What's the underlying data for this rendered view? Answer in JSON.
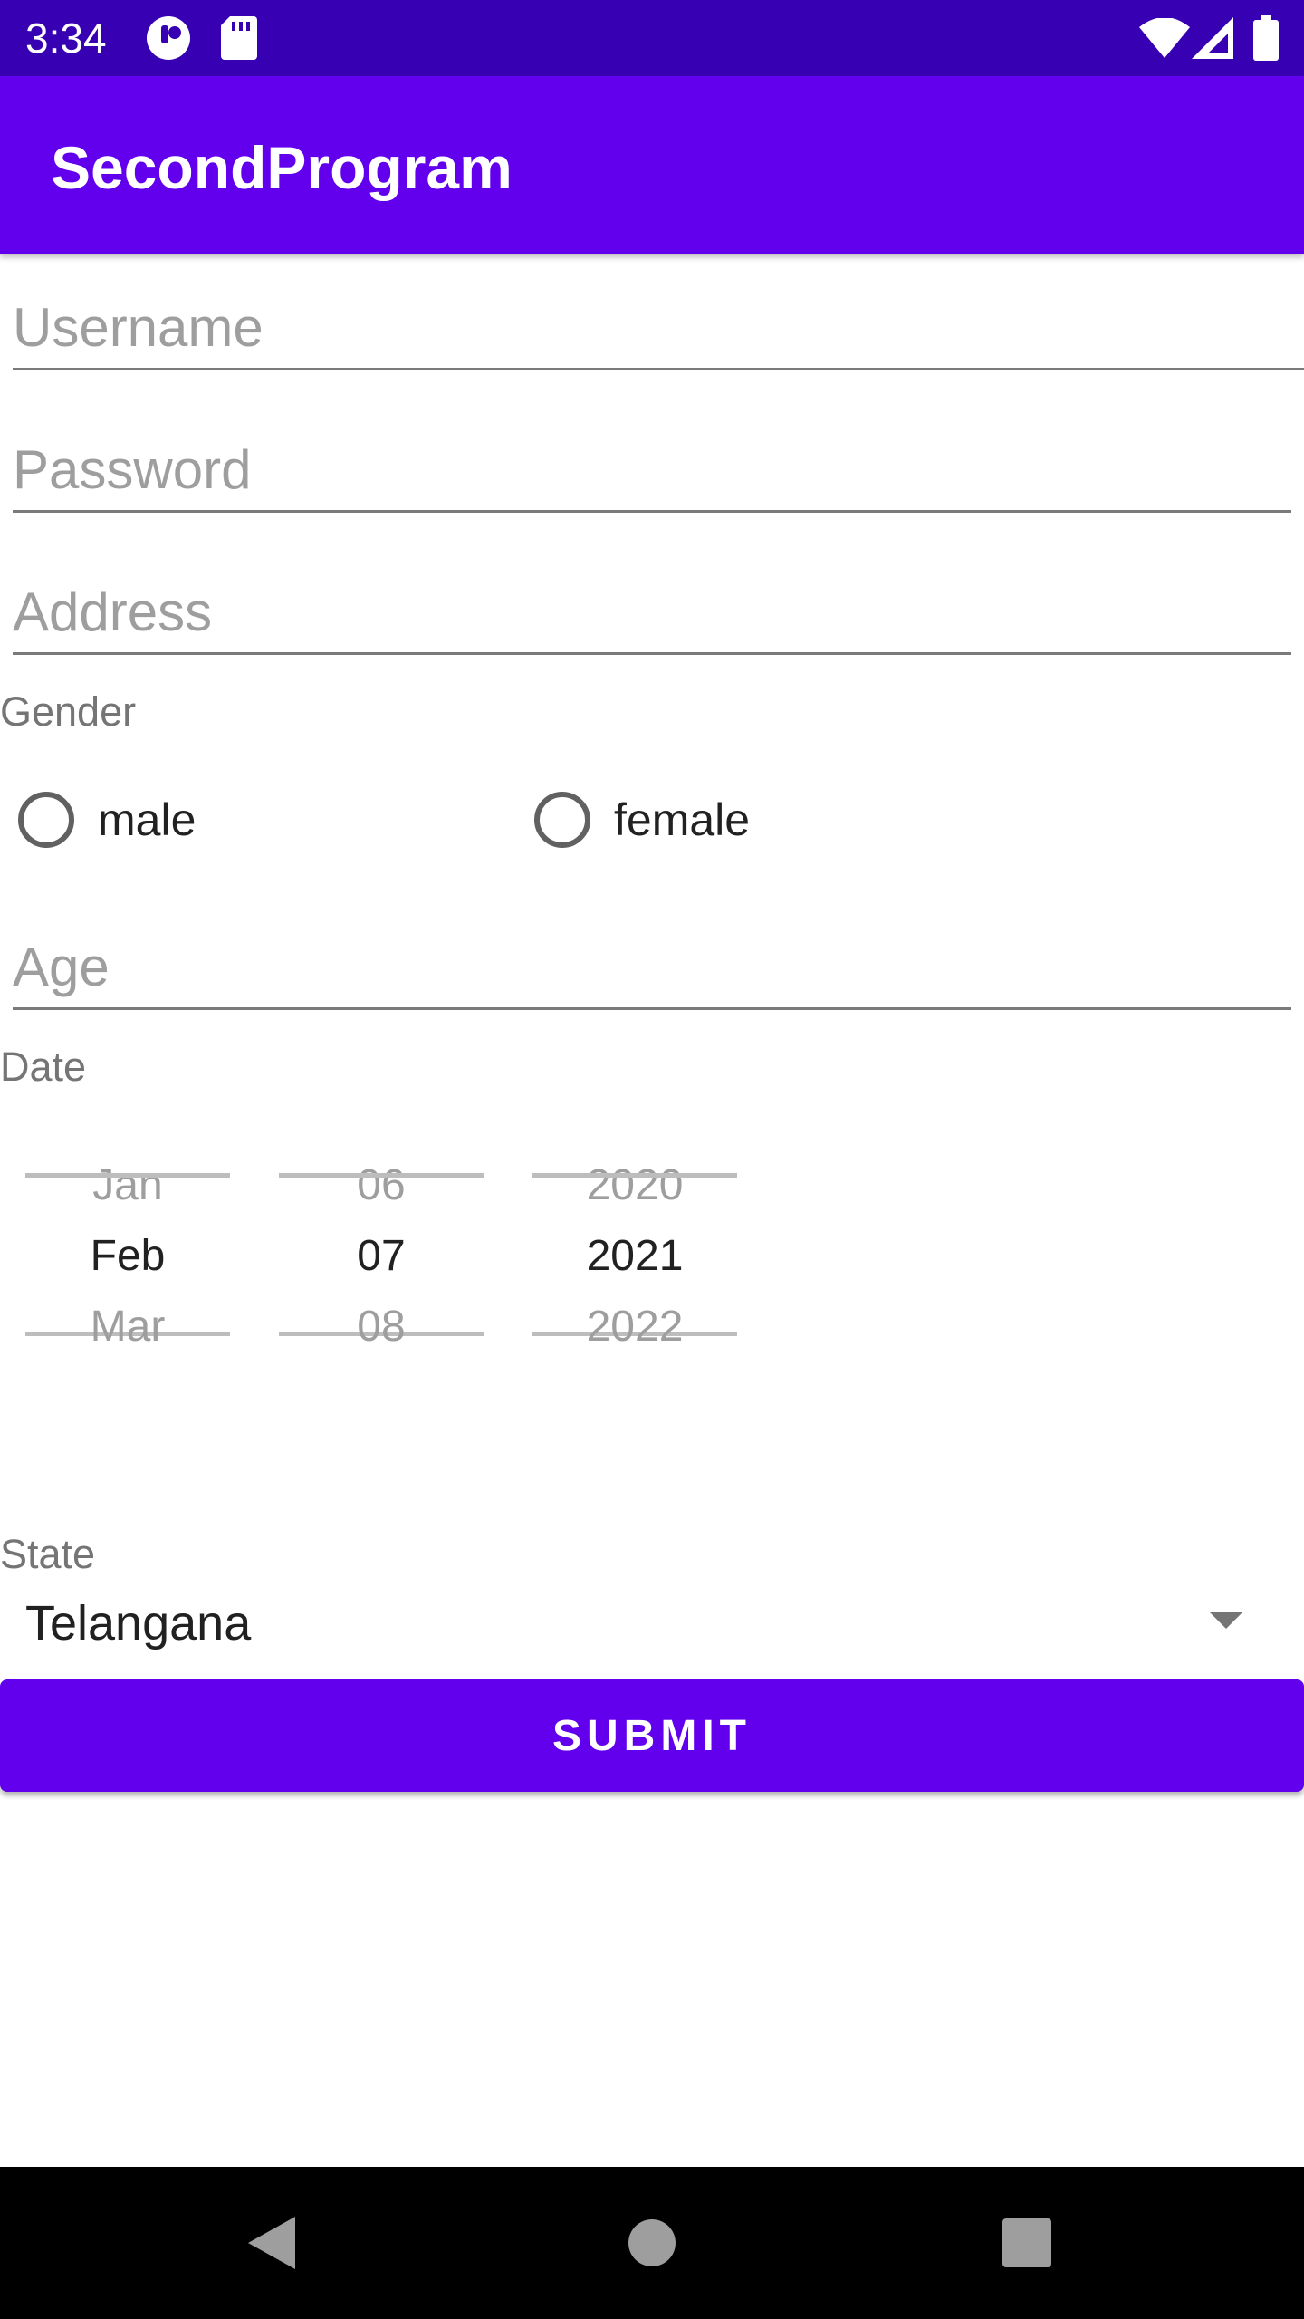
{
  "status_bar": {
    "time": "3:34",
    "icons": [
      "media-icon",
      "sd-card-icon",
      "wifi-icon",
      "signal-icon",
      "battery-icon"
    ]
  },
  "app_bar": {
    "title": "SecondProgram",
    "color": "#6200ee"
  },
  "form": {
    "username": {
      "value": "",
      "placeholder": "Username"
    },
    "password": {
      "value": "",
      "placeholder": "Password"
    },
    "address": {
      "value": "",
      "placeholder": "Address"
    },
    "gender": {
      "label": "Gender",
      "options": [
        {
          "label": "male",
          "checked": false
        },
        {
          "label": "female",
          "checked": false
        }
      ]
    },
    "age": {
      "value": "",
      "placeholder": "Age"
    },
    "date": {
      "label": "Date",
      "month": {
        "prev": "Jan",
        "selected": "Feb",
        "next": "Mar"
      },
      "day": {
        "prev": "06",
        "selected": "07",
        "next": "08"
      },
      "year": {
        "prev": "2020",
        "selected": "2021",
        "next": "2022"
      }
    },
    "state": {
      "label": "State",
      "selected": "Telangana"
    },
    "submit_label": "SUBMIT"
  },
  "nav_bar": {
    "buttons": [
      "back-icon",
      "home-icon",
      "recents-icon"
    ]
  }
}
